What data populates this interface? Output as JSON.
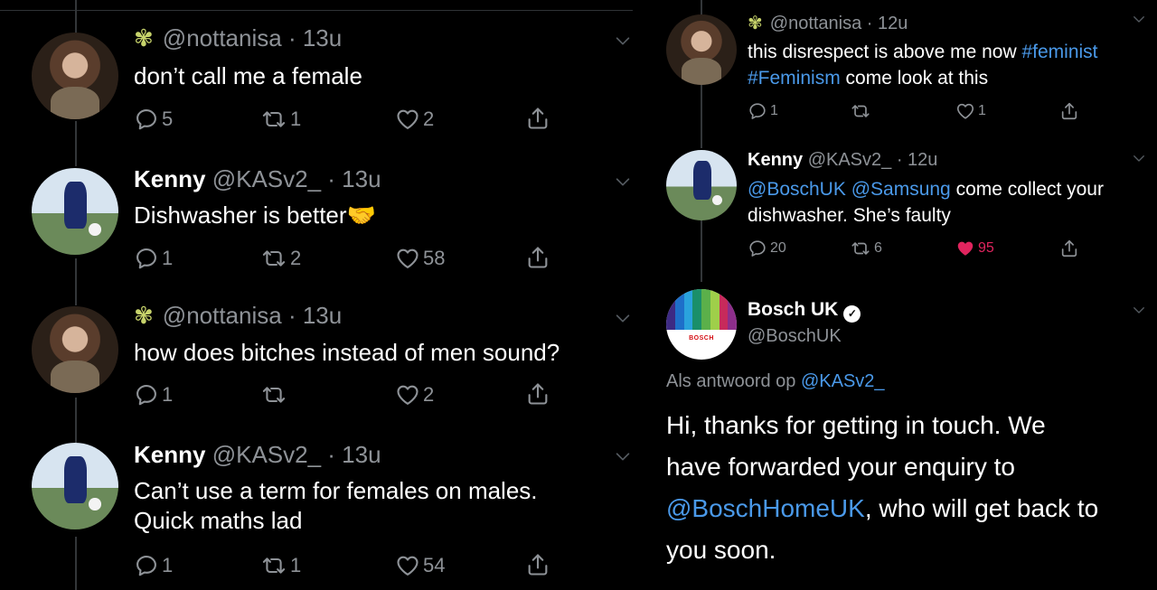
{
  "left_thread": [
    {
      "handle": "@nottanisa",
      "time": "13u",
      "text": "don’t call me a female",
      "replies": "5",
      "retweets": "1",
      "likes": "2"
    },
    {
      "name": "Kenny",
      "handle": "@KASv2_",
      "time": "13u",
      "text": "Dishwasher is better",
      "emoji": "🤝",
      "replies": "1",
      "retweets": "2",
      "likes": "58"
    },
    {
      "handle": "@nottanisa",
      "time": "13u",
      "text": "how does bitches instead of men sound?",
      "replies": "1",
      "retweets": "",
      "likes": "2"
    },
    {
      "name": "Kenny",
      "handle": "@KASv2_",
      "time": "13u",
      "text_line1": "Can’t use a term for females on males.",
      "text_line2": "Quick maths lad",
      "replies": "1",
      "retweets": "1",
      "likes": "54"
    }
  ],
  "right_thread": {
    "tweet1": {
      "handle": "@nottanisa",
      "time": "12u",
      "text_part1": "this disrespect is above me now ",
      "tag1": "#feminist",
      "tag2": "#Feminism",
      "text_part2": " come look at this",
      "replies": "1",
      "retweets": "",
      "likes": "1"
    },
    "tweet2": {
      "name": "Kenny",
      "handle": "@KASv2_",
      "time": "12u",
      "mention1": "@BoschUK",
      "mention2": "@Samsung",
      "text_part1": " come collect your",
      "text_line2": "dishwasher. She’s faulty",
      "replies": "20",
      "retweets": "6",
      "likes": "95"
    },
    "bosch": {
      "name": "Bosch UK",
      "handle": "@BoschUK",
      "logo_text": "BOSCH",
      "reply_prefix": "Als antwoord op ",
      "reply_to": "@KASv2_",
      "line1": "Hi, thanks for getting in touch. We",
      "line2": "have forwarded your enquiry to",
      "mention": "@BoschHomeUK",
      "line3_rest": ", who will get back to",
      "line4": "you soon."
    }
  },
  "colors": {
    "background": "#000000",
    "text": "#ffffff",
    "muted": "#8e9297",
    "link": "#4a99e9",
    "like_active": "#e0245e",
    "bosch_red": "#d40f14"
  },
  "icons": [
    "reply-icon",
    "retweet-icon",
    "like-icon",
    "share-icon",
    "chevron-down-icon",
    "verified-icon",
    "butterfly-emoji-icon",
    "handshake-emoji-icon"
  ]
}
